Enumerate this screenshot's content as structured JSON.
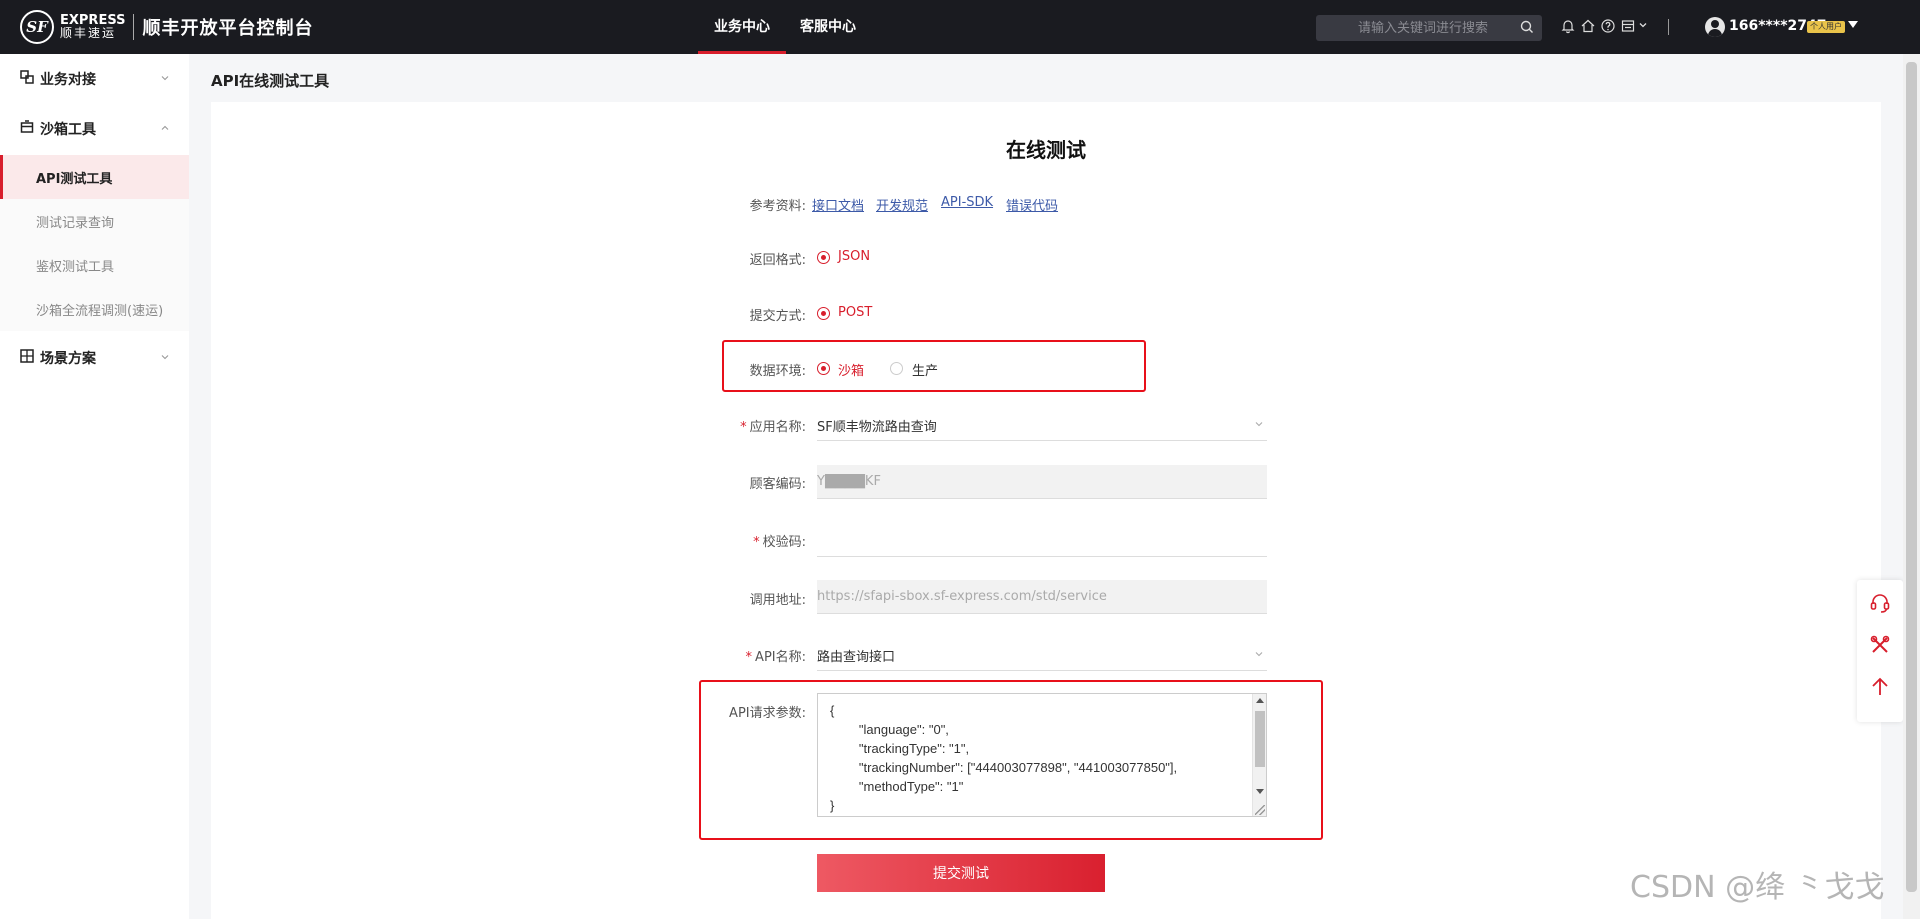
{
  "header": {
    "logo_mark": "SF",
    "logo_en": "EXPRESS",
    "logo_cn": "顺丰速运",
    "platform_title": "顺丰开放平台控制台",
    "tabs": [
      {
        "label": "业务中心",
        "active": true
      },
      {
        "label": "客服中心",
        "active": false
      }
    ],
    "search_placeholder": "请输入关键词进行搜索",
    "user": {
      "name": "166****2747",
      "badge": "个人用户"
    }
  },
  "sidebar": {
    "groups": [
      {
        "label": "业务对接",
        "expanded": false
      },
      {
        "label": "沙箱工具",
        "expanded": true,
        "items": [
          {
            "label": "API测试工具",
            "active": true
          },
          {
            "label": "测试记录查询",
            "active": false
          },
          {
            "label": "鉴权测试工具",
            "active": false
          },
          {
            "label": "沙箱全流程调测(速运)",
            "active": false
          }
        ]
      },
      {
        "label": "场景方案",
        "expanded": false
      }
    ]
  },
  "page_title": "API在线测试工具",
  "form": {
    "title": "在线测试",
    "references": {
      "label": "参考资料:",
      "links": [
        "接口文档",
        "开发规范",
        "API-SDK",
        "错误代码"
      ]
    },
    "return_format": {
      "label": "返回格式:",
      "option": "JSON"
    },
    "submit_method": {
      "label": "提交方式:",
      "option": "POST"
    },
    "data_env": {
      "label": "数据环境:",
      "options": [
        "沙箱",
        "生产"
      ],
      "selected": "沙箱"
    },
    "app_name": {
      "label": "应用名称:",
      "required": true,
      "value": "SF顺丰物流路由查询"
    },
    "customer_code": {
      "label": "顾客编码:",
      "value": "Y████KF"
    },
    "check_word": {
      "label": "校验码:",
      "required": true,
      "value": ""
    },
    "call_url": {
      "label": "调用地址:",
      "placeholder": "https://sfapi-sbox.sf-express.com/std/service"
    },
    "api_name": {
      "label": "API名称:",
      "required": true,
      "value": "路由查询接口"
    },
    "api_params": {
      "label": "API请求参数:",
      "value": "{\n        \"language\": \"0\",\n        \"trackingType\": \"1\",\n        \"trackingNumber\": [\"444003077898\", \"441003077850\"],\n        \"methodType\": \"1\"\n}"
    },
    "submit_label": "提交测试"
  },
  "watermark": "CSDN @绛 ⺀戈戈",
  "colors": {
    "brand_red": "#d81e2c",
    "header_bg": "#1a1b20",
    "highlight_box": "#e8101a",
    "link": "#3d5aa8"
  }
}
